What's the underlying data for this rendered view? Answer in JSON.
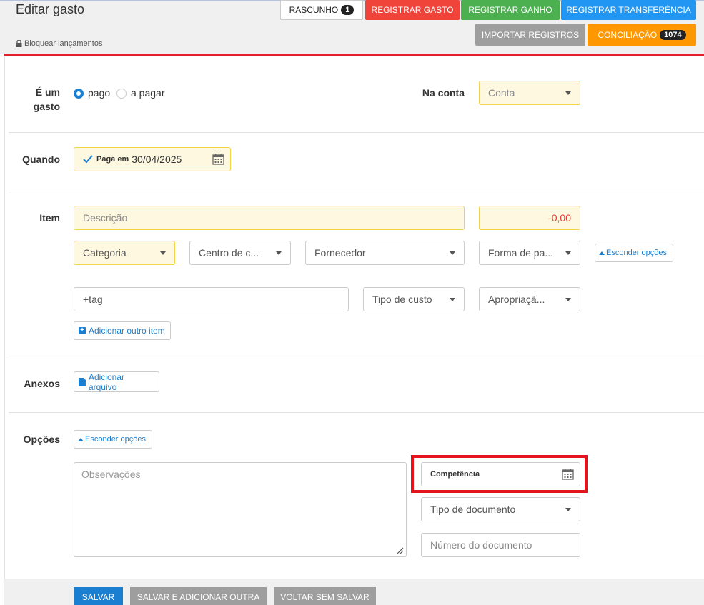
{
  "header": {
    "title": "Editar gasto",
    "lock_label": "Bloquear lançamentos",
    "draft_label": "RASCUNHO",
    "draft_count": "1",
    "register_expense": "REGISTRAR GASTO",
    "register_income": "REGISTRAR GANHO",
    "register_transfer": "REGISTRAR TRANSFERÊNCIA",
    "import_records": "IMPORTAR REGISTROS",
    "reconciliation": "CONCILIAÇÃO",
    "reconciliation_count": "1074"
  },
  "status": {
    "label": "É um gasto",
    "options": [
      {
        "label": "pago",
        "selected": true
      },
      {
        "label": "a pagar",
        "selected": false
      }
    ]
  },
  "account": {
    "label": "Na conta",
    "placeholder": "Conta"
  },
  "when": {
    "label": "Quando",
    "paid_prefix": "Paga em",
    "date": "30/04/2025"
  },
  "item": {
    "label": "Item",
    "description_placeholder": "Descrição",
    "amount": "-0,00",
    "category": "Categoria",
    "cost_center": "Centro de c...",
    "supplier": "Fornecedor",
    "payment_method": "Forma de pa...",
    "hide_options": "Esconder opções",
    "tag_placeholder": "+tag",
    "cost_type": "Tipo de custo",
    "appropriation": "Apropriaçã...",
    "add_item": "Adicionar outro item"
  },
  "attachments": {
    "label": "Anexos",
    "add_file": "Adicionar arquivo"
  },
  "options": {
    "label": "Opções",
    "hide_options": "Esconder opções",
    "notes_placeholder": "Observações",
    "competence": "Competência",
    "document_type": "Tipo de documento",
    "document_number_placeholder": "Número do documento"
  },
  "footer": {
    "save": "SALVAR",
    "save_add": "SALVAR E ADICIONAR OUTRA",
    "back": "VOLTAR SEM SALVAR"
  },
  "colors": {
    "accent_blue": "#1a7fd0",
    "red": "#f0443b",
    "green": "#4caf50",
    "orange": "#ff9800",
    "field_yellow": "#fff8e1",
    "highlight": "#e2151c"
  }
}
